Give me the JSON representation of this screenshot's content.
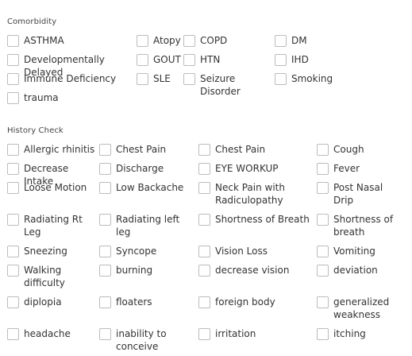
{
  "comorbidity": {
    "title": "Comorbidity",
    "items": [
      {
        "label": "ASTHMA",
        "checked": false
      },
      {
        "label": "Atopy",
        "checked": false
      },
      {
        "label": "COPD",
        "checked": false
      },
      {
        "label": "DM",
        "checked": false
      },
      {
        "label": "Developmentally Delayed",
        "checked": false
      },
      {
        "label": "GOUT",
        "checked": false
      },
      {
        "label": "HTN",
        "checked": false
      },
      {
        "label": "IHD",
        "checked": false
      },
      {
        "label": "Immune Deficiency",
        "checked": false
      },
      {
        "label": "SLE",
        "checked": false
      },
      {
        "label": "Seizure Disorder",
        "checked": false
      },
      {
        "label": "Smoking",
        "checked": false
      },
      {
        "label": "trauma",
        "checked": false
      }
    ]
  },
  "history": {
    "title": "History Check",
    "items": [
      {
        "label": "Allergic rhinitis",
        "checked": false
      },
      {
        "label": "Chest Pain",
        "checked": false
      },
      {
        "label": "Chest Pain",
        "checked": false
      },
      {
        "label": "Cough",
        "checked": false
      },
      {
        "label": "Decrease Intake",
        "checked": false
      },
      {
        "label": "Discharge",
        "checked": false
      },
      {
        "label": "EYE WORKUP",
        "checked": false
      },
      {
        "label": "Fever",
        "checked": false
      },
      {
        "label": "Loose Motion",
        "checked": false
      },
      {
        "label": "Low Backache",
        "checked": false
      },
      {
        "label": "Neck Pain with Radiculopathy",
        "checked": false
      },
      {
        "label": "Post Nasal Drip",
        "checked": false
      },
      {
        "label": "Radiating Rt Leg",
        "checked": false
      },
      {
        "label": "Radiating left leg",
        "checked": false
      },
      {
        "label": "Shortness of Breath",
        "checked": false
      },
      {
        "label": "Shortness of breath",
        "checked": false
      },
      {
        "label": "Sneezing",
        "checked": false
      },
      {
        "label": "Syncope",
        "checked": false
      },
      {
        "label": "Vision Loss",
        "checked": false
      },
      {
        "label": "Vomiting",
        "checked": false
      },
      {
        "label": "Walking difficulty",
        "checked": false
      },
      {
        "label": "burning",
        "checked": false
      },
      {
        "label": "decrease vision",
        "checked": false
      },
      {
        "label": "deviation",
        "checked": false
      },
      {
        "label": "diplopia",
        "checked": false
      },
      {
        "label": "floaters",
        "checked": false
      },
      {
        "label": "foreign body",
        "checked": false
      },
      {
        "label": "generalized weakness",
        "checked": false
      },
      {
        "label": "headache",
        "checked": false
      },
      {
        "label": "inability to conceive",
        "checked": false
      },
      {
        "label": "irritation",
        "checked": false
      },
      {
        "label": "itching",
        "checked": false
      }
    ]
  }
}
